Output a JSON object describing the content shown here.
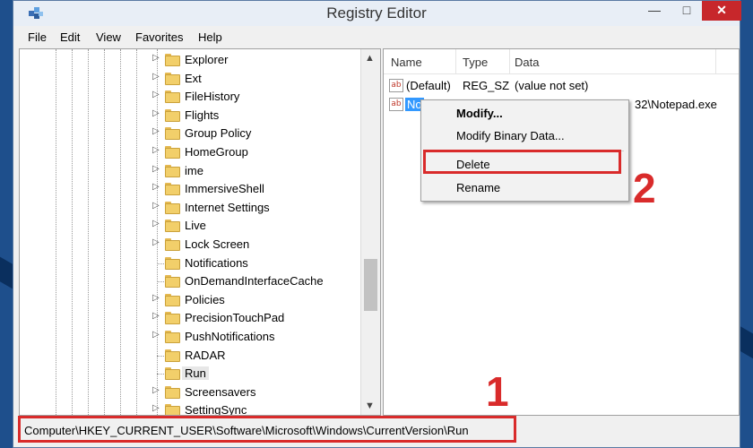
{
  "window": {
    "title": "Registry Editor",
    "controls": {
      "minimize": "—",
      "maximize": "□",
      "close": "✕"
    }
  },
  "menu": [
    "File",
    "Edit",
    "View",
    "Favorites",
    "Help"
  ],
  "tree": {
    "items": [
      {
        "label": "Explorer",
        "expandable": true
      },
      {
        "label": "Ext",
        "expandable": true
      },
      {
        "label": "FileHistory",
        "expandable": true
      },
      {
        "label": "Flights",
        "expandable": true
      },
      {
        "label": "Group Policy",
        "expandable": true
      },
      {
        "label": "HomeGroup",
        "expandable": true
      },
      {
        "label": "ime",
        "expandable": true
      },
      {
        "label": "ImmersiveShell",
        "expandable": true
      },
      {
        "label": "Internet Settings",
        "expandable": true
      },
      {
        "label": "Live",
        "expandable": true
      },
      {
        "label": "Lock Screen",
        "expandable": true
      },
      {
        "label": "Notifications",
        "expandable": false
      },
      {
        "label": "OnDemandInterfaceCache",
        "expandable": false
      },
      {
        "label": "Policies",
        "expandable": true
      },
      {
        "label": "PrecisionTouchPad",
        "expandable": true
      },
      {
        "label": "PushNotifications",
        "expandable": true
      },
      {
        "label": "RADAR",
        "expandable": false
      },
      {
        "label": "Run",
        "expandable": false,
        "selected": true
      },
      {
        "label": "Screensavers",
        "expandable": true
      },
      {
        "label": "SettingSync",
        "expandable": true
      }
    ]
  },
  "list": {
    "columns": [
      "Name",
      "Type",
      "Data"
    ],
    "rows": [
      {
        "name": "(Default)",
        "type": "REG_SZ",
        "data": "(value not set)",
        "icon": "ab"
      },
      {
        "name": "No",
        "type": "",
        "data": "32\\Notepad.exe",
        "icon": "ab",
        "selected": true
      }
    ]
  },
  "context_menu": {
    "items": [
      "Modify...",
      "Modify Binary Data...",
      "Delete",
      "Rename"
    ]
  },
  "status_path": "Computer\\HKEY_CURRENT_USER\\Software\\Microsoft\\Windows\\CurrentVersion\\Run",
  "annotations": {
    "step1": "1",
    "step2": "2"
  },
  "colors": {
    "highlight_box": "#d92b2b",
    "selection": "#3399ff",
    "close_button": "#c7272b"
  }
}
